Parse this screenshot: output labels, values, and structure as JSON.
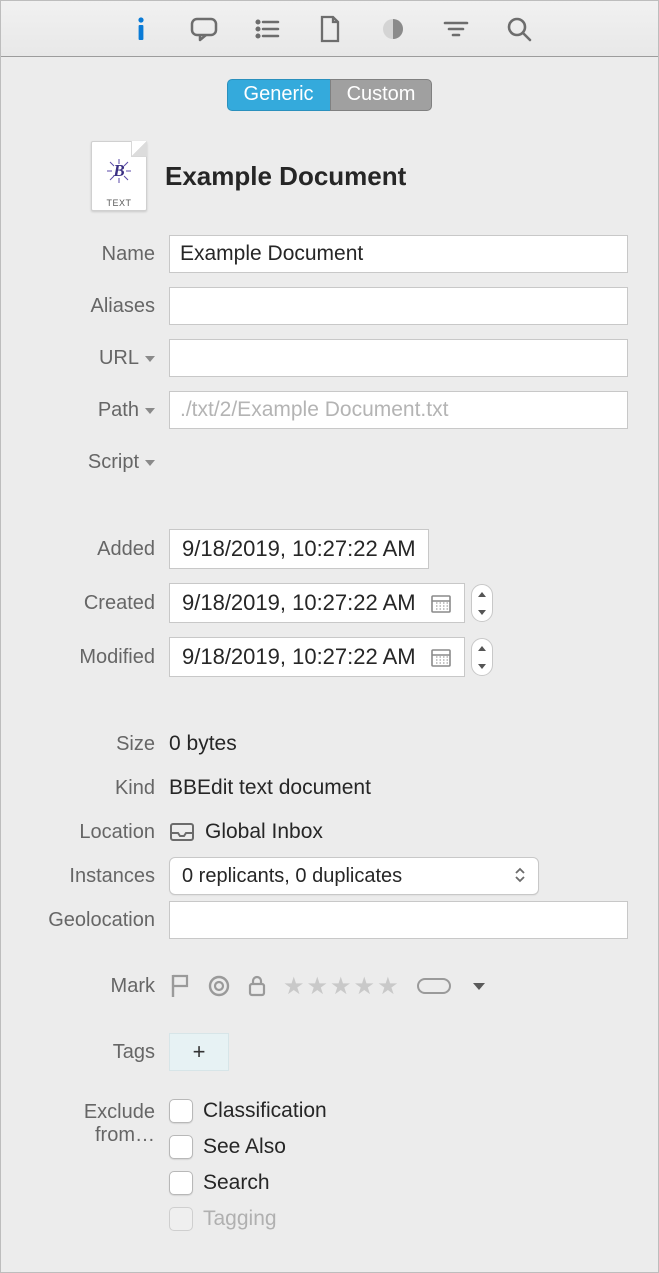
{
  "segmented": {
    "generic": "Generic",
    "custom": "Custom"
  },
  "document": {
    "title": "Example Document",
    "icon_badge": "B",
    "icon_caption": "TEXT"
  },
  "labels": {
    "name": "Name",
    "aliases": "Aliases",
    "url": "URL",
    "path": "Path",
    "script": "Script",
    "added": "Added",
    "created": "Created",
    "modified": "Modified",
    "size": "Size",
    "kind": "Kind",
    "location": "Location",
    "instances": "Instances",
    "geolocation": "Geolocation",
    "mark": "Mark",
    "tags": "Tags",
    "exclude": "Exclude from…"
  },
  "fields": {
    "name": "Example Document",
    "aliases": "",
    "url": "",
    "path_placeholder": "./txt/2/Example Document.txt",
    "added": "9/18/2019, 10:27:22 AM",
    "created": "9/18/2019, 10:27:22 AM",
    "modified": "9/18/2019, 10:27:22 AM",
    "size": "0 bytes",
    "kind": "BBEdit text document",
    "location": "Global Inbox",
    "instances": "0 replicants, 0 duplicates",
    "geolocation": ""
  },
  "tags": {
    "add": "+"
  },
  "exclude": {
    "classification": "Classification",
    "see_also": "See Also",
    "search": "Search",
    "tagging": "Tagging"
  }
}
